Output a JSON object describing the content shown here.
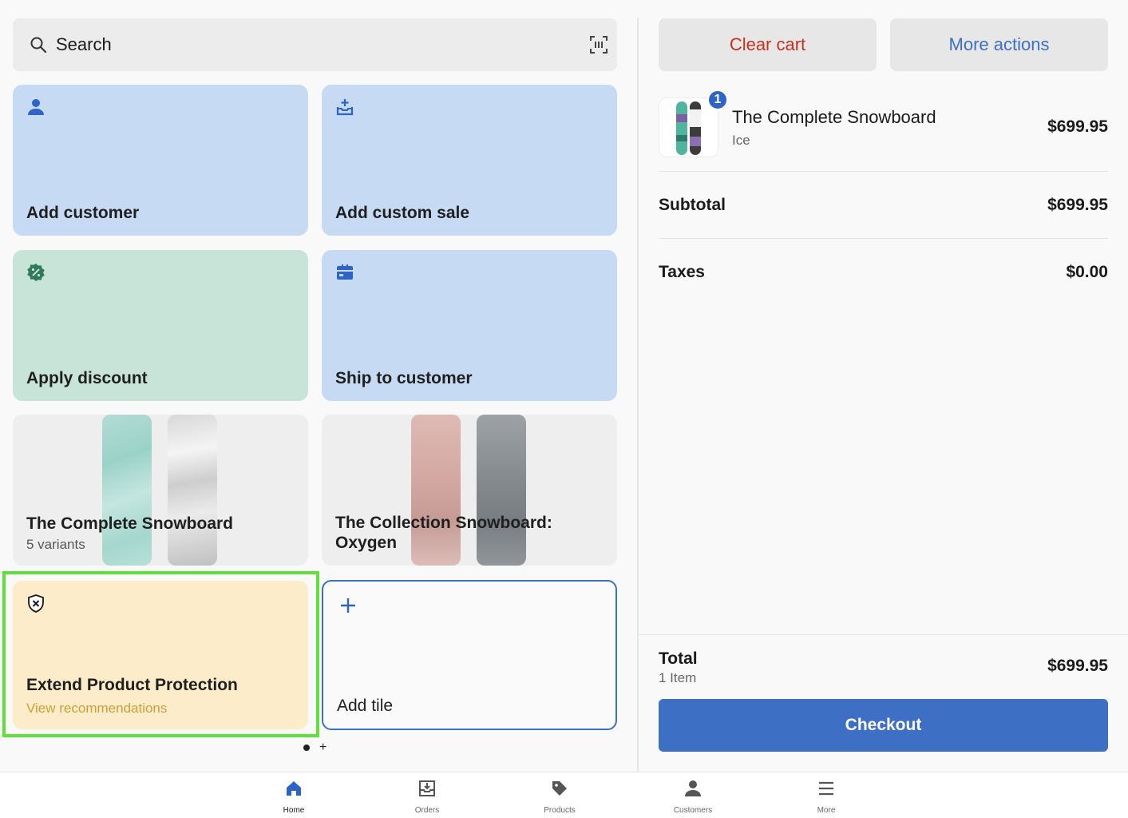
{
  "search": {
    "label": "Search"
  },
  "tiles": [
    {
      "title": "Add customer",
      "icon": "person-icon"
    },
    {
      "title": "Add custom sale",
      "icon": "tray-add-icon"
    },
    {
      "title": "Apply discount",
      "icon": "discount-badge-icon"
    },
    {
      "title": "Ship to customer",
      "icon": "shipping-box-icon"
    },
    {
      "title": "The Complete Snowboard",
      "subtitle": "5 variants"
    },
    {
      "title": "The Collection Snowboard: Oxygen"
    },
    {
      "title": "Extend Product Protection",
      "subtitle": "View recommendations",
      "icon": "shield-x-icon"
    },
    {
      "title": "Add tile",
      "icon": "plus-icon"
    }
  ],
  "pager": {
    "plus": "+"
  },
  "cart": {
    "clear_label": "Clear cart",
    "more_label": "More actions",
    "item": {
      "name": "The Complete Snowboard",
      "variant": "Ice",
      "price": "$699.95",
      "qty": "1"
    },
    "subtotal_label": "Subtotal",
    "subtotal_value": "$699.95",
    "taxes_label": "Taxes",
    "taxes_value": "$0.00",
    "total_label": "Total",
    "total_items": "1 Item",
    "total_value": "$699.95",
    "checkout_label": "Checkout"
  },
  "nav": {
    "items": [
      {
        "label": "Home",
        "icon": "home-icon",
        "active": true
      },
      {
        "label": "Orders",
        "icon": "orders-icon"
      },
      {
        "label": "Products",
        "icon": "tag-icon"
      },
      {
        "label": "Customers",
        "icon": "person-icon"
      },
      {
        "label": "More",
        "icon": "menu-icon"
      }
    ]
  },
  "colors": {
    "accent": "#3d6fc5",
    "danger": "#cc2f1d",
    "tile_blue": "#c6daf3",
    "tile_green": "#c8e3d8",
    "tile_yellow": "#fdecc9",
    "highlight": "#5fe03a"
  }
}
